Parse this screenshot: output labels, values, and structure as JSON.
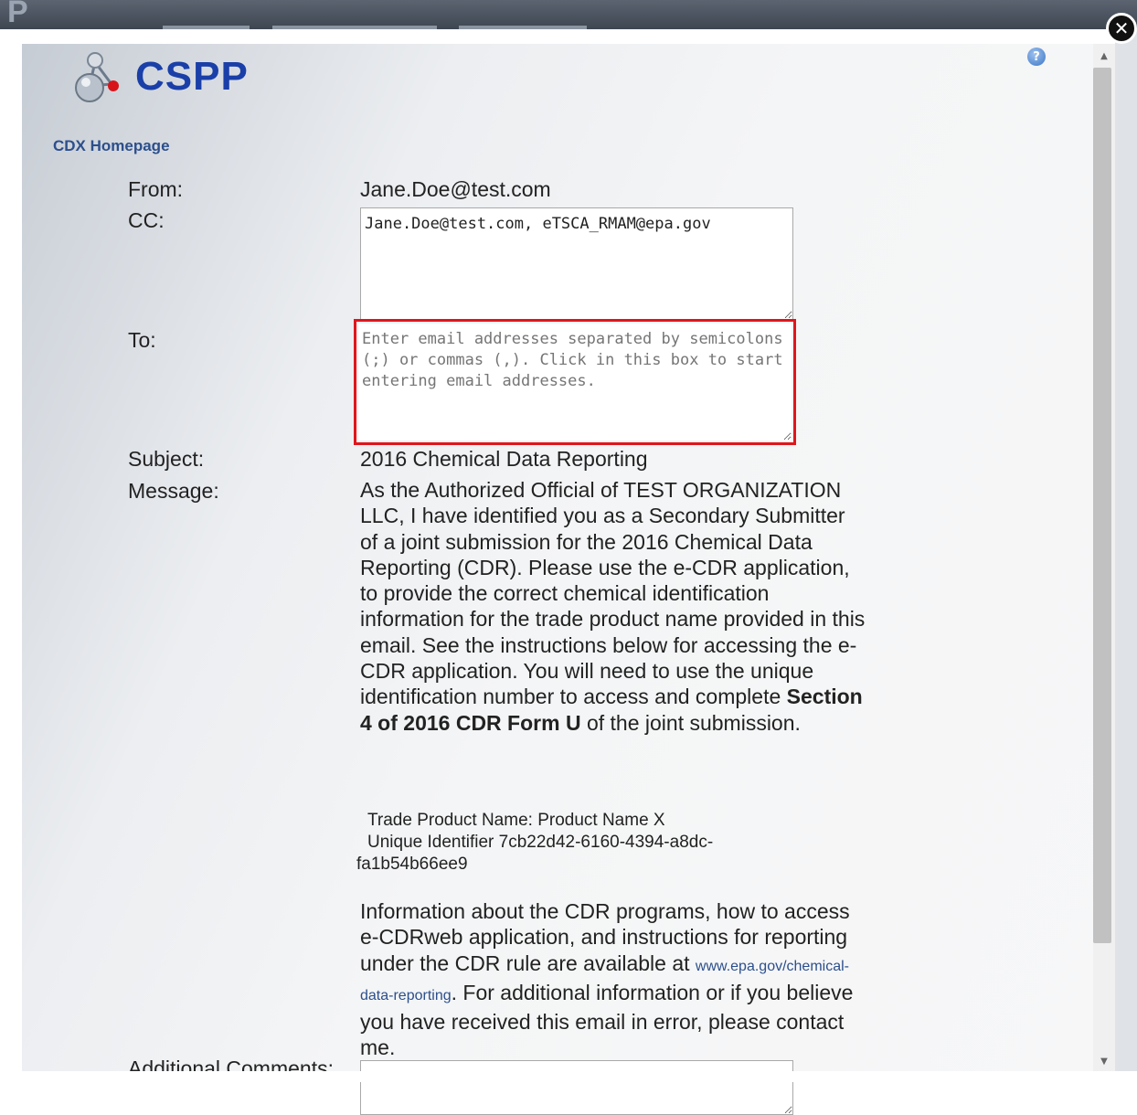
{
  "backdrop": {
    "logo_glyph": "P"
  },
  "modal": {
    "close_glyph": "✕",
    "help_glyph": "?",
    "brand_name": "CSPP",
    "cdx_link": "CDX Homepage"
  },
  "form": {
    "from_label": "From:",
    "from_value": "Jane.Doe@test.com",
    "cc_label": "CC:",
    "cc_value": "Jane.Doe@test.com, eTSCA_RMAM@epa.gov",
    "to_label": "To:",
    "to_placeholder": "Enter email addresses separated by semicolons (;) or commas (,). Click in this box to start entering email addresses.",
    "subject_label": "Subject:",
    "subject_value": "2016 Chemical Data Reporting",
    "message_label": "Message:",
    "message_intro": "As the Authorized Official of TEST ORGANIZATION LLC, I have identified you as a Secondary Submitter of a joint submission for the 2016 Chemical Data Reporting (CDR). Please use the e-CDR application, to provide the correct chemical identification information for the trade product name provided in this email. See the instructions below for accessing the e-CDR application. You will need to use the unique identification number to access and complete ",
    "message_bold": "Section 4 of 2016 CDR Form U",
    "message_end": " of the joint submission.",
    "trade_product": "Trade Product Name: Product Name X",
    "unique_id_line1": "Unique Identifier 7cb22d42-6160-4394-a8dc-",
    "unique_id_line2": "fa1b54b66ee9",
    "info_before": "Information about the CDR programs, how to access e-CDRweb application, and instructions for reporting under the CDR rule are available at ",
    "info_link": "www.epa.gov/chemical-data-reporting",
    "info_after": ". For additional information or if you believe you have received this email in error, please contact me.",
    "additional_comments_label": "Additional Comments:"
  },
  "colors": {
    "brand": "#1a3fa8",
    "link": "#2c4f8c",
    "highlight": "#e0161b"
  }
}
